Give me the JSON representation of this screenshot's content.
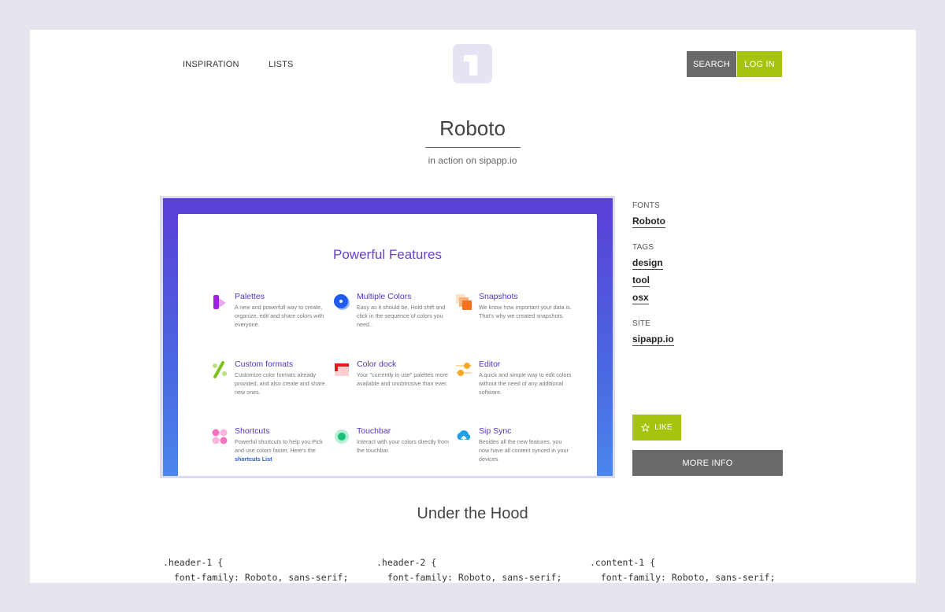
{
  "nav": {
    "inspiration": "INSPIRATION",
    "lists": "LISTS",
    "search": "SEARCH",
    "login": "LOG IN"
  },
  "header": {
    "title": "Roboto",
    "subtitle": "in action on sipapp.io"
  },
  "preview": {
    "title": "Powerful Features",
    "features": [
      {
        "title": "Palettes",
        "desc": "A new and powerfull way to create, organize, edit and share colors with everyone.",
        "icon": "palettes-icon"
      },
      {
        "title": "Multiple Colors",
        "desc": "Easy as it should be. Hold shift and click in the sequence of colors you need..",
        "icon": "multiple-colors-icon"
      },
      {
        "title": "Snapshots",
        "desc": "We know how important your data is. That's why we created snapshots.",
        "icon": "snapshots-icon"
      },
      {
        "title": "Custom formats",
        "desc": "Customize color formats already provided, and also create and share new ones.",
        "icon": "custom-formats-icon"
      },
      {
        "title": "Color dock",
        "desc": "Your \"currently in use\" palettes more available and unobtrusive than ever.",
        "icon": "color-dock-icon"
      },
      {
        "title": "Editor",
        "desc": "A quick and simple way to edit colors without the need of any additional software.",
        "icon": "editor-icon"
      },
      {
        "title": "Shortcuts",
        "desc": "Powerful shortcuts to help you Pick and use colors faster. Here's the",
        "link": "shortcuts List",
        "icon": "shortcuts-icon"
      },
      {
        "title": "Touchbar",
        "desc": "Interact with your colors directly from the touchbar.",
        "icon": "touchbar-icon"
      },
      {
        "title": "Sip Sync",
        "desc": "Besides all the new features, you now have all content synced in your devices.",
        "icon": "sip-sync-icon"
      }
    ]
  },
  "sidebar": {
    "fonts_label": "FONTS",
    "fonts": [
      "Roboto"
    ],
    "tags_label": "TAGS",
    "tags": [
      "design",
      "tool",
      "osx"
    ],
    "site_label": "SITE",
    "site": "sipapp.io",
    "like": "LIKE",
    "more_info": "MORE INFO"
  },
  "hood": {
    "title": "Under the Hood",
    "blocks": [
      {
        "selector": ".header-1 {",
        "rule": "  font-family: Roboto, sans-serif;"
      },
      {
        "selector": ".header-2 {",
        "rule": "  font-family: Roboto, sans-serif;"
      },
      {
        "selector": ".content-1 {",
        "rule": "  font-family: Roboto, sans-serif;"
      }
    ]
  },
  "colors": {
    "background": "#e5e5ee",
    "accent_green": "#a8c30e",
    "button_gray": "#6a6a6a",
    "logo_bg": "#e4e4f5",
    "feature_title": "#5433c6"
  }
}
